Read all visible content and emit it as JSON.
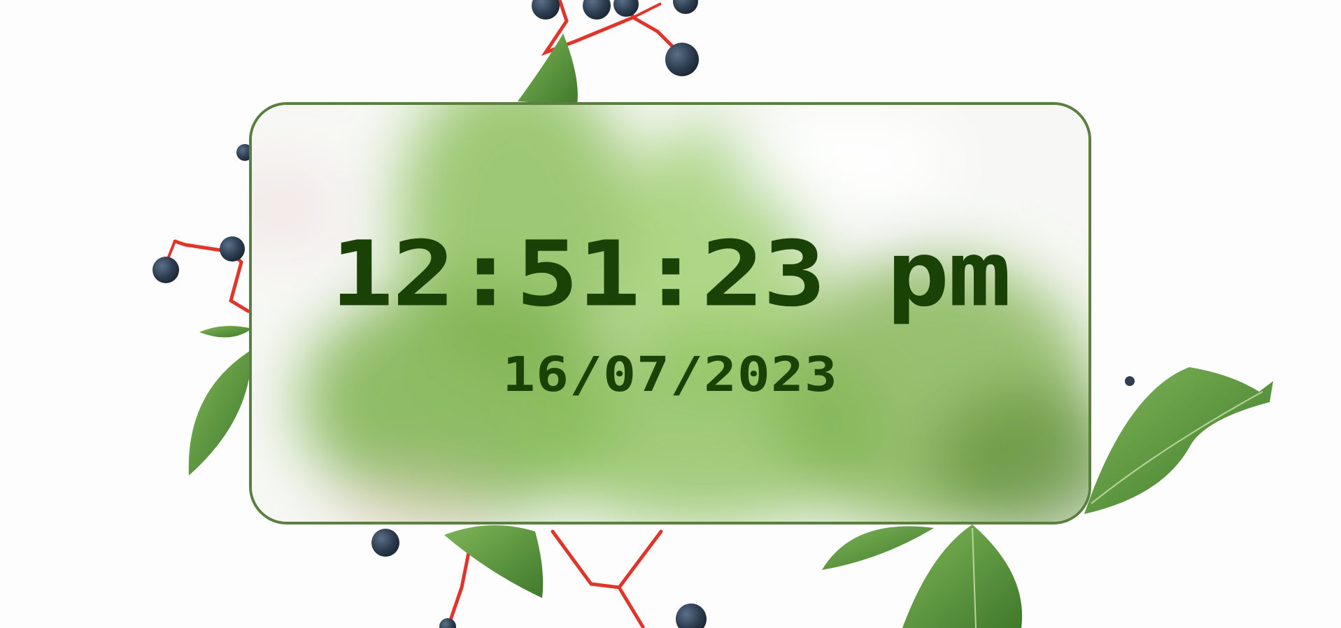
{
  "clock": {
    "time": "12:51:23 pm",
    "date": "16/07/2023"
  },
  "colors": {
    "card_border": "#5a7f40",
    "text": "#1a4207",
    "leaf": "#5d9a3c",
    "stem": "#e0352b",
    "berry": "#2e3f52"
  }
}
